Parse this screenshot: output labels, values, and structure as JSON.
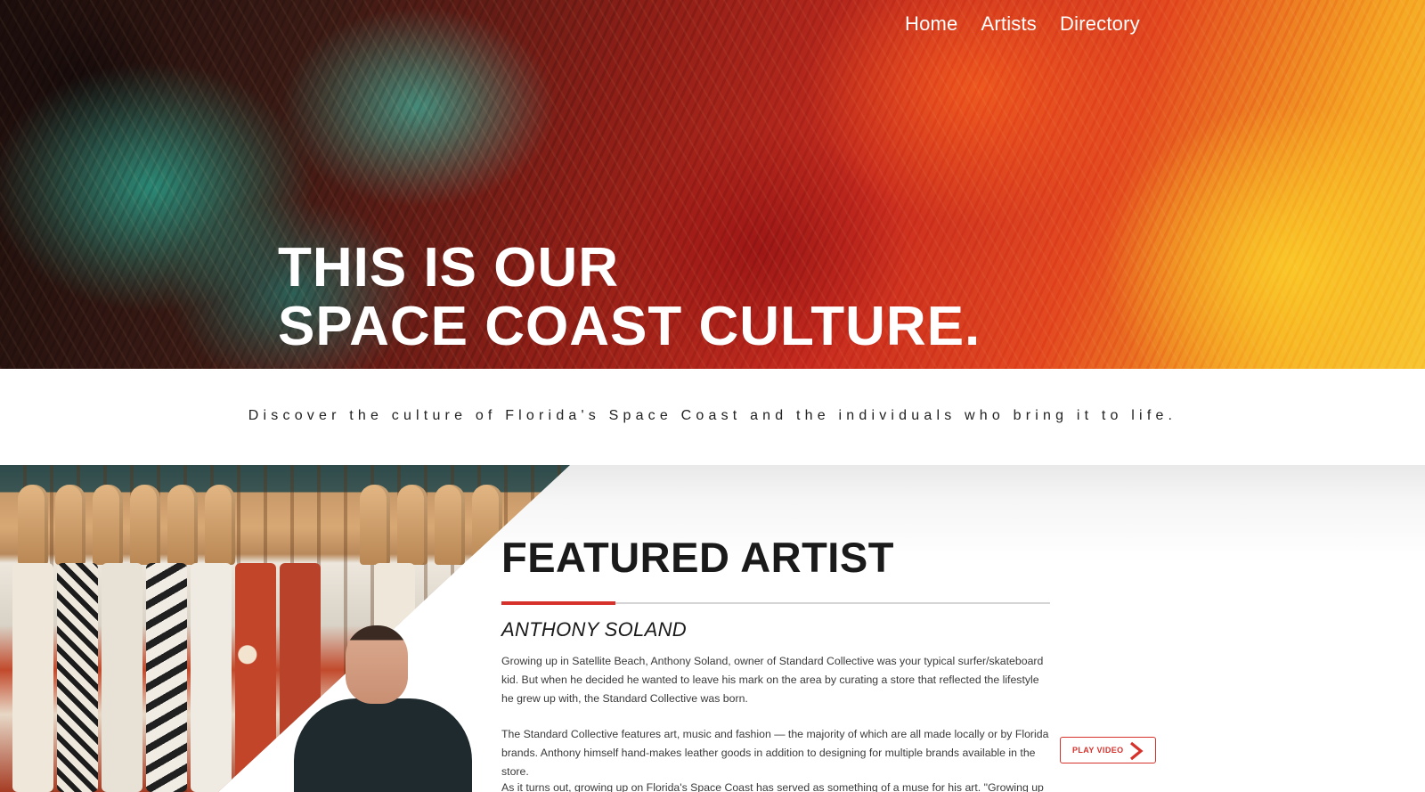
{
  "nav": {
    "items": [
      {
        "label": "Home"
      },
      {
        "label": "Artists"
      },
      {
        "label": "Directory"
      }
    ]
  },
  "hero": {
    "title_line1": "THIS IS OUR",
    "title_line2": "SPACE COAST CULTURE."
  },
  "tagline": "Discover the culture of Florida's Space Coast and the individuals who bring it to life.",
  "featured": {
    "heading": "FEATURED ARTIST",
    "artist_name": "ANTHONY SOLAND",
    "paragraphs": [
      "Growing up in Satellite Beach, Anthony Soland, owner of Standard Collective was your typical surfer/skateboard kid. But when he decided he wanted to leave his mark on the area by curating a store that reflected the lifestyle he grew up with, the Standard Collective was born.",
      "The Standard Collective features art, music and fashion — the majority of which are all made locally or by Florida brands. Anthony himself hand-makes leather goods in addition to designing for multiple brands available in the store.",
      "As it turns out, growing up on Florida's Space Coast has served as something of a muse for his art. \"Growing up on the"
    ],
    "play_button_label": "PLAY VIDEO",
    "play_icon": "chevron-right-icon"
  },
  "colors": {
    "accent": "#d6312b",
    "heading": "#1a1a1a",
    "body_text": "#3a3a3a"
  }
}
